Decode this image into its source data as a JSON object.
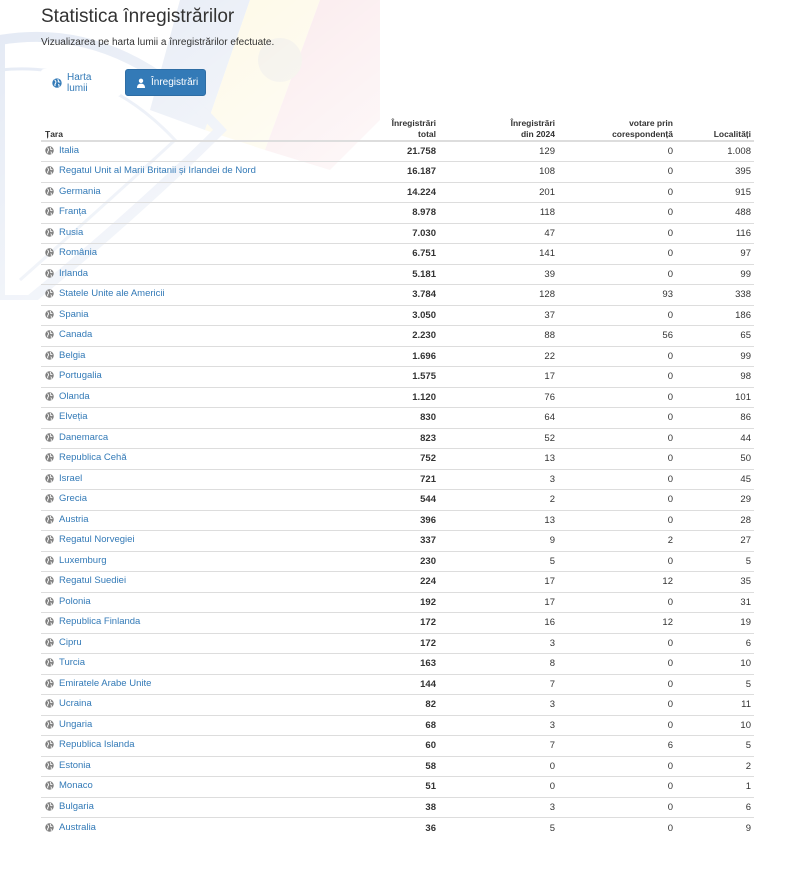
{
  "page": {
    "title": "Statistica înregistrărilor",
    "subtitle": "Vizualizarea pe harta lumii a înregistrărilor efectuate."
  },
  "tabs": [
    {
      "label": "Harta lumii",
      "icon": "globe-icon",
      "active": false
    },
    {
      "label": "Înregistrări",
      "icon": "user-icon",
      "active": true
    }
  ],
  "colors": {
    "accent": "#337ab7",
    "border": "#dddddd",
    "text": "#333333"
  },
  "table": {
    "headers": {
      "country": "Țara",
      "total_line1": "Înregistrări",
      "total_line2": "total",
      "y2024_line1": "Înregistrări",
      "y2024_line2": "din 2024",
      "postal_line1": "votare prin",
      "postal_line2": "corespondență",
      "localities": "Localități"
    },
    "rows": [
      {
        "country": "Italia",
        "total": "21.758",
        "y2024": "129",
        "postal": "0",
        "localities": "1.008"
      },
      {
        "country": "Regatul Unit al Marii Britanii și Irlandei de Nord",
        "total": "16.187",
        "y2024": "108",
        "postal": "0",
        "localities": "395"
      },
      {
        "country": "Germania",
        "total": "14.224",
        "y2024": "201",
        "postal": "0",
        "localities": "915"
      },
      {
        "country": "Franța",
        "total": "8.978",
        "y2024": "118",
        "postal": "0",
        "localities": "488"
      },
      {
        "country": "Rusia",
        "total": "7.030",
        "y2024": "47",
        "postal": "0",
        "localities": "116"
      },
      {
        "country": "România",
        "total": "6.751",
        "y2024": "141",
        "postal": "0",
        "localities": "97"
      },
      {
        "country": "Irlanda",
        "total": "5.181",
        "y2024": "39",
        "postal": "0",
        "localities": "99"
      },
      {
        "country": "Statele Unite ale Americii",
        "total": "3.784",
        "y2024": "128",
        "postal": "93",
        "localities": "338"
      },
      {
        "country": "Spania",
        "total": "3.050",
        "y2024": "37",
        "postal": "0",
        "localities": "186"
      },
      {
        "country": "Canada",
        "total": "2.230",
        "y2024": "88",
        "postal": "56",
        "localities": "65"
      },
      {
        "country": "Belgia",
        "total": "1.696",
        "y2024": "22",
        "postal": "0",
        "localities": "99"
      },
      {
        "country": "Portugalia",
        "total": "1.575",
        "y2024": "17",
        "postal": "0",
        "localities": "98"
      },
      {
        "country": "Olanda",
        "total": "1.120",
        "y2024": "76",
        "postal": "0",
        "localities": "101"
      },
      {
        "country": "Elveția",
        "total": "830",
        "y2024": "64",
        "postal": "0",
        "localities": "86"
      },
      {
        "country": "Danemarca",
        "total": "823",
        "y2024": "52",
        "postal": "0",
        "localities": "44"
      },
      {
        "country": "Republica Cehă",
        "total": "752",
        "y2024": "13",
        "postal": "0",
        "localities": "50"
      },
      {
        "country": "Israel",
        "total": "721",
        "y2024": "3",
        "postal": "0",
        "localities": "45"
      },
      {
        "country": "Grecia",
        "total": "544",
        "y2024": "2",
        "postal": "0",
        "localities": "29"
      },
      {
        "country": "Austria",
        "total": "396",
        "y2024": "13",
        "postal": "0",
        "localities": "28"
      },
      {
        "country": "Regatul Norvegiei",
        "total": "337",
        "y2024": "9",
        "postal": "2",
        "localities": "27"
      },
      {
        "country": "Luxemburg",
        "total": "230",
        "y2024": "5",
        "postal": "0",
        "localities": "5"
      },
      {
        "country": "Regatul Suediei",
        "total": "224",
        "y2024": "17",
        "postal": "12",
        "localities": "35"
      },
      {
        "country": "Polonia",
        "total": "192",
        "y2024": "17",
        "postal": "0",
        "localities": "31"
      },
      {
        "country": "Republica Finlanda",
        "total": "172",
        "y2024": "16",
        "postal": "12",
        "localities": "19"
      },
      {
        "country": "Cipru",
        "total": "172",
        "y2024": "3",
        "postal": "0",
        "localities": "6"
      },
      {
        "country": "Turcia",
        "total": "163",
        "y2024": "8",
        "postal": "0",
        "localities": "10"
      },
      {
        "country": "Emiratele Arabe Unite",
        "total": "144",
        "y2024": "7",
        "postal": "0",
        "localities": "5"
      },
      {
        "country": "Ucraina",
        "total": "82",
        "y2024": "3",
        "postal": "0",
        "localities": "11"
      },
      {
        "country": "Ungaria",
        "total": "68",
        "y2024": "3",
        "postal": "0",
        "localities": "10"
      },
      {
        "country": "Republica Islanda",
        "total": "60",
        "y2024": "7",
        "postal": "6",
        "localities": "5"
      },
      {
        "country": "Estonia",
        "total": "58",
        "y2024": "0",
        "postal": "0",
        "localities": "2"
      },
      {
        "country": "Monaco",
        "total": "51",
        "y2024": "0",
        "postal": "0",
        "localities": "1"
      },
      {
        "country": "Bulgaria",
        "total": "38",
        "y2024": "3",
        "postal": "0",
        "localities": "6"
      },
      {
        "country": "Australia",
        "total": "36",
        "y2024": "5",
        "postal": "0",
        "localities": "9"
      }
    ]
  }
}
